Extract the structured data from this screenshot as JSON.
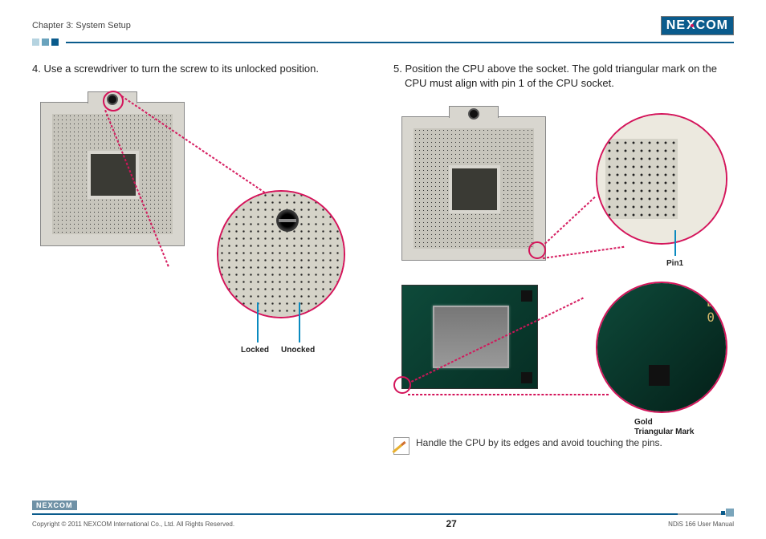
{
  "header": {
    "chapter": "Chapter 3: System Setup",
    "logo_left": "NE",
    "logo_x": "X",
    "logo_right": "COM"
  },
  "left": {
    "step": "4. Use a screwdriver to turn the screw to its unlocked position.",
    "label_locked": "Locked",
    "label_unlocked": "Unocked"
  },
  "right": {
    "step": "5. Position the CPU above the socket. The gold triangular mark on the CPU must align with pin 1 of the CPU socket.",
    "label_pin1": "Pin1",
    "label_gold1": "Gold",
    "label_gold2": "Triangular Mark",
    "zoom_cpu_text1": "D",
    "zoom_cpu_text2": "0",
    "note": "Handle the CPU by its edges and avoid touching the pins."
  },
  "footer": {
    "logo_small": "NEXCOM",
    "copyright": "Copyright © 2011 NEXCOM International Co., Ltd. All Rights Reserved.",
    "page": "27",
    "manual": "NDiS 166 User Manual"
  }
}
